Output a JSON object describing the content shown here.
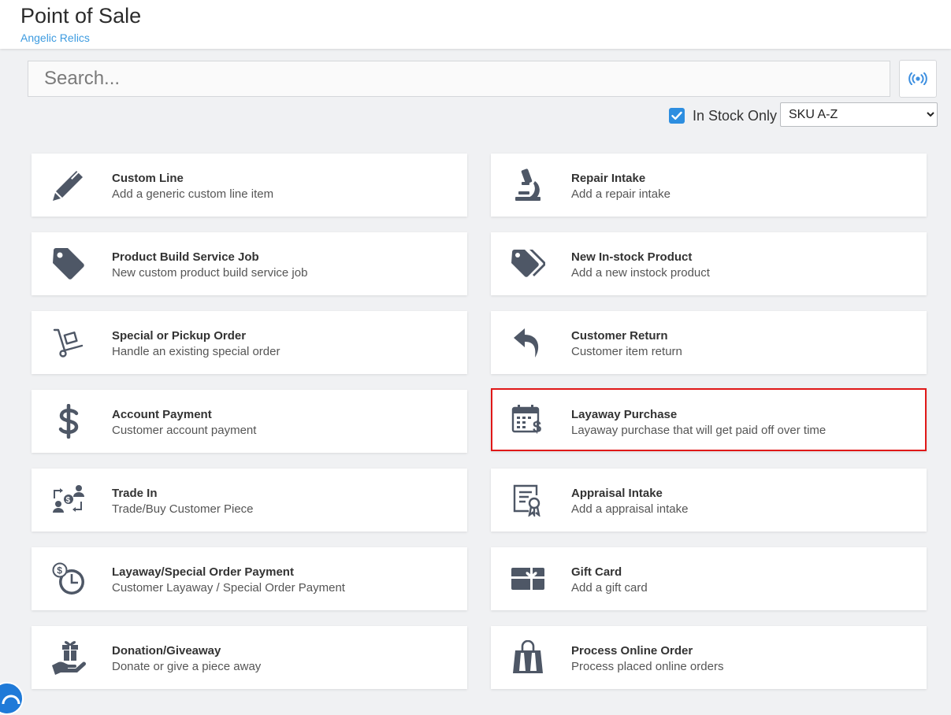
{
  "header": {
    "title": "Point of Sale",
    "subtitle": "Angelic Relics"
  },
  "search": {
    "placeholder": "Search...",
    "value": ""
  },
  "filters": {
    "in_stock_label": "In Stock Only",
    "in_stock_checked": true,
    "sort_selected": "SKU A-Z"
  },
  "tiles": [
    {
      "title": "Custom Line",
      "desc": "Add a generic custom line item",
      "icon": "pencil-icon"
    },
    {
      "title": "Repair Intake",
      "desc": "Add a repair intake",
      "icon": "microscope-icon"
    },
    {
      "title": "Product Build Service Job",
      "desc": "New custom product build service job",
      "icon": "tag-icon"
    },
    {
      "title": "New In-stock Product",
      "desc": "Add a new instock product",
      "icon": "tags-icon"
    },
    {
      "title": "Special or Pickup Order",
      "desc": "Handle an existing special order",
      "icon": "hand-truck-icon"
    },
    {
      "title": "Customer Return",
      "desc": "Customer item return",
      "icon": "reply-arrow-icon"
    },
    {
      "title": "Account Payment",
      "desc": "Customer account payment",
      "icon": "dollar-icon"
    },
    {
      "title": "Layaway Purchase",
      "desc": "Layaway purchase that will get paid off over time",
      "icon": "calendar-dollar-icon",
      "highlighted": true
    },
    {
      "title": "Trade In",
      "desc": "Trade/Buy Customer Piece",
      "icon": "trade-exchange-icon"
    },
    {
      "title": "Appraisal Intake",
      "desc": "Add a appraisal intake",
      "icon": "certificate-icon"
    },
    {
      "title": "Layaway/Special Order Payment",
      "desc": "Customer Layaway / Special Order Payment",
      "icon": "clock-dollar-icon"
    },
    {
      "title": "Gift Card",
      "desc": "Add a gift card",
      "icon": "gift-card-icon"
    },
    {
      "title": "Donation/Giveaway",
      "desc": "Donate or give a piece away",
      "icon": "hand-gift-icon"
    },
    {
      "title": "Process Online Order",
      "desc": "Process placed online orders",
      "icon": "shopping-bag-icon"
    }
  ],
  "colors": {
    "accent": "#2d8ee0",
    "icon": "#4e5766",
    "highlight": "#e01818",
    "subtitle": "#3d9be0"
  }
}
